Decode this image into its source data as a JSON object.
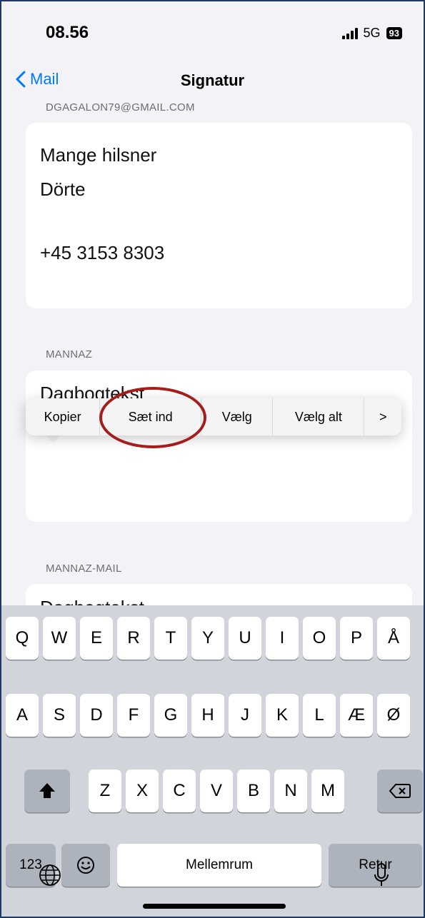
{
  "status_bar": {
    "time": "08.56",
    "network": "5G",
    "battery": "93"
  },
  "nav": {
    "back_label": "Mail",
    "title": "Signatur"
  },
  "sections": [
    {
      "header": "DGAGALON79@GMAIL.COM",
      "lines": [
        "Mange hilsner",
        "Dörte",
        "",
        "+45 3153 8303"
      ]
    },
    {
      "header": "MANNAZ",
      "peek_text": "Dagbogtekst"
    },
    {
      "header": "MANNAZ-MAIL",
      "peek_text": "Dagbogtekst"
    }
  ],
  "callout_menu": {
    "items": [
      "Kopier",
      "Sæt ind",
      "Vælg",
      "Vælg alt"
    ],
    "more": ">"
  },
  "keyboard": {
    "row1": [
      "Q",
      "W",
      "E",
      "R",
      "T",
      "Y",
      "U",
      "I",
      "O",
      "P",
      "Å"
    ],
    "row2": [
      "A",
      "S",
      "D",
      "F",
      "G",
      "H",
      "J",
      "K",
      "L",
      "Æ",
      "Ø"
    ],
    "row3": [
      "Z",
      "X",
      "C",
      "V",
      "B",
      "N",
      "M"
    ],
    "numbers_label": "123",
    "space_label": "Mellemrum",
    "return_label": "Retur"
  },
  "colors": {
    "accent": "#007aff",
    "highlight": "#a51c1c",
    "background": "#f2f2f7"
  }
}
